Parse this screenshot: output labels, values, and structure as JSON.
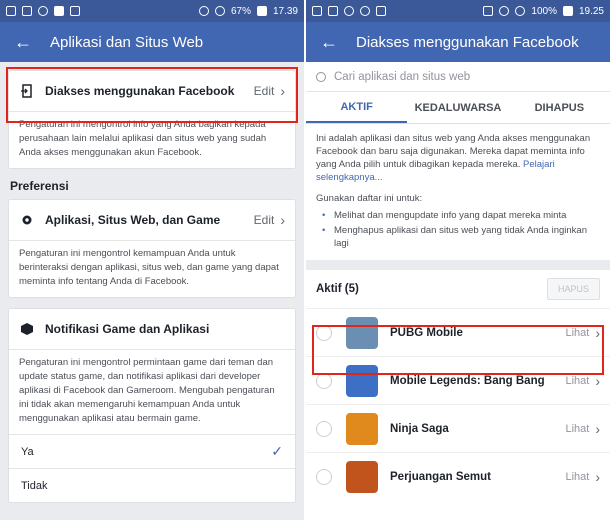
{
  "left": {
    "status": {
      "battery": "67%",
      "time": "17.39"
    },
    "title": "Aplikasi dan Situs Web",
    "section1": {
      "label": "Diakses menggunakan Facebook",
      "edit": "Edit",
      "desc": "Pengaturan ini mengontrol info yang Anda bagikan kepada perusahaan lain melalui aplikasi dan situs web yang sudah Anda akses menggunakan akun Facebook."
    },
    "preferensi": "Preferensi",
    "section2": {
      "label": "Aplikasi, Situs Web, dan Game",
      "edit": "Edit",
      "desc": "Pengaturan ini mengontrol kemampuan Anda untuk berinteraksi dengan aplikasi, situs web, dan game yang dapat meminta info tentang Anda di Facebook."
    },
    "section3": {
      "label": "Notifikasi Game dan Aplikasi",
      "desc": "Pengaturan ini mengontrol permintaan game dari teman dan update status game, dan notifikasi aplikasi dari developer aplikasi di Facebook dan Gameroom. Mengubah pengaturan ini tidak akan memengaruhi kemampuan Anda untuk menggunakan aplikasi atau bermain game.",
      "options": [
        "Ya",
        "Tidak"
      ]
    }
  },
  "right": {
    "status": {
      "battery": "100%",
      "time": "19.25"
    },
    "title": "Diakses menggunakan Facebook",
    "search_placeholder": "Cari aplikasi dan situs web",
    "tabs": [
      "AKTIF",
      "KEDALUWARSA",
      "DIHAPUS"
    ],
    "info_text": "Ini adalah aplikasi dan situs web yang Anda akses menggunakan Facebook dan baru saja digunakan. Mereka dapat meminta info yang Anda pilih untuk dibagikan kepada mereka.",
    "info_link": "Pelajari selengkapnya...",
    "usage_title": "Gunakan daftar ini untuk:",
    "usage_items": [
      "Melihat dan mengupdate info yang dapat mereka minta",
      "Menghapus aplikasi dan situs web yang tidak Anda inginkan lagi"
    ],
    "active_label": "Aktif (5)",
    "hapus": "HAPUS",
    "lihat": "Lihat",
    "apps": [
      {
        "name": "PUBG Mobile",
        "color": "#6a8fb3"
      },
      {
        "name": "Mobile Legends: Bang Bang",
        "color": "#3d6fc4"
      },
      {
        "name": "Ninja Saga",
        "color": "#e08a1e"
      },
      {
        "name": "Perjuangan Semut",
        "color": "#c0541c"
      }
    ]
  },
  "colors": {
    "facebook_blue": "#4267b2",
    "highlight": "#e1251b"
  }
}
